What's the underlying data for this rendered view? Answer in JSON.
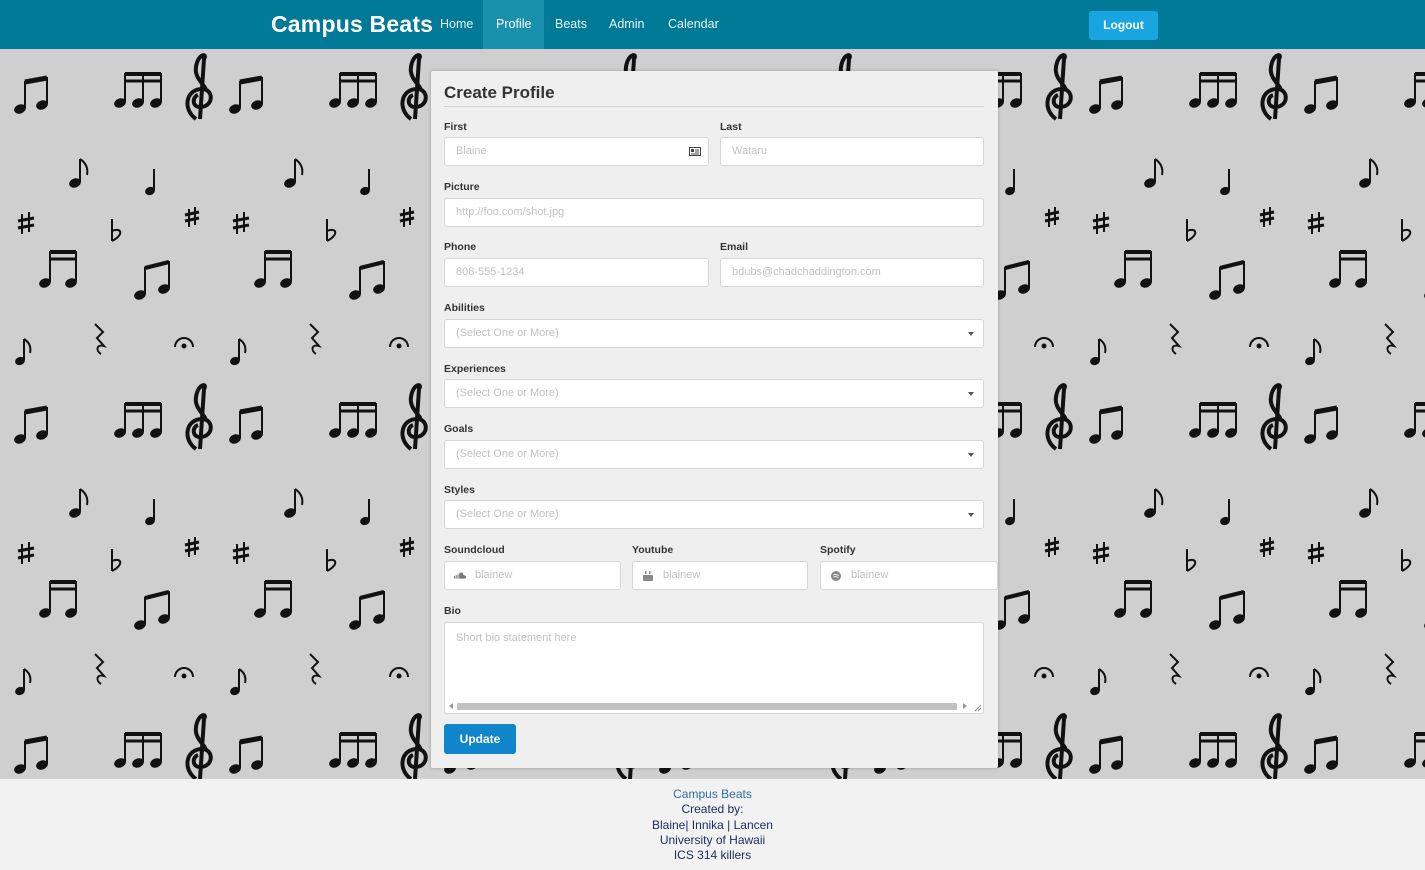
{
  "navbar": {
    "brand": "Campus Beats",
    "items": [
      {
        "label": "Home",
        "active": false
      },
      {
        "label": "Profile",
        "active": true
      },
      {
        "label": "Beats",
        "active": false
      },
      {
        "label": "Admin",
        "active": false
      },
      {
        "label": "Calendar",
        "active": false
      }
    ],
    "logout_label": "Logout"
  },
  "form": {
    "title": "Create Profile",
    "first": {
      "label": "First",
      "placeholder": "Blaine"
    },
    "last": {
      "label": "Last",
      "placeholder": "Wataru"
    },
    "picture": {
      "label": "Picture",
      "placeholder": "http://foo.com/shot.jpg"
    },
    "phone": {
      "label": "Phone",
      "placeholder": "808-555-1234"
    },
    "email": {
      "label": "Email",
      "placeholder": "bdubs@chadchaddington.com"
    },
    "abilities": {
      "label": "Abilities",
      "placeholder": "(Select One or More)"
    },
    "experiences": {
      "label": "Experiences",
      "placeholder": "(Select One or More)"
    },
    "goals": {
      "label": "Goals",
      "placeholder": "(Select One or More)"
    },
    "styles": {
      "label": "Styles",
      "placeholder": "(Select One or More)"
    },
    "soundcloud": {
      "label": "Soundcloud",
      "placeholder": "blainew",
      "icon": "soundcloud-icon"
    },
    "youtube": {
      "label": "Youtube",
      "placeholder": "blainew",
      "icon": "youtube-icon"
    },
    "spotify": {
      "label": "Spotify",
      "placeholder": "blainew",
      "icon": "spotify-icon"
    },
    "bio": {
      "label": "Bio",
      "placeholder": "Short bio statement here"
    },
    "update_label": "Update"
  },
  "footer": {
    "brand": "Campus Beats",
    "created_by": "Created by:",
    "authors": "Blaine| Innika | Lancen",
    "university": "University of Hawaii",
    "course": "ICS 314 killers"
  },
  "colors": {
    "navbar": "#017a98",
    "nav_active": "#1991ac",
    "logout": "#19a6e0",
    "update": "#0f86cc",
    "background": "#cfcfcf"
  }
}
